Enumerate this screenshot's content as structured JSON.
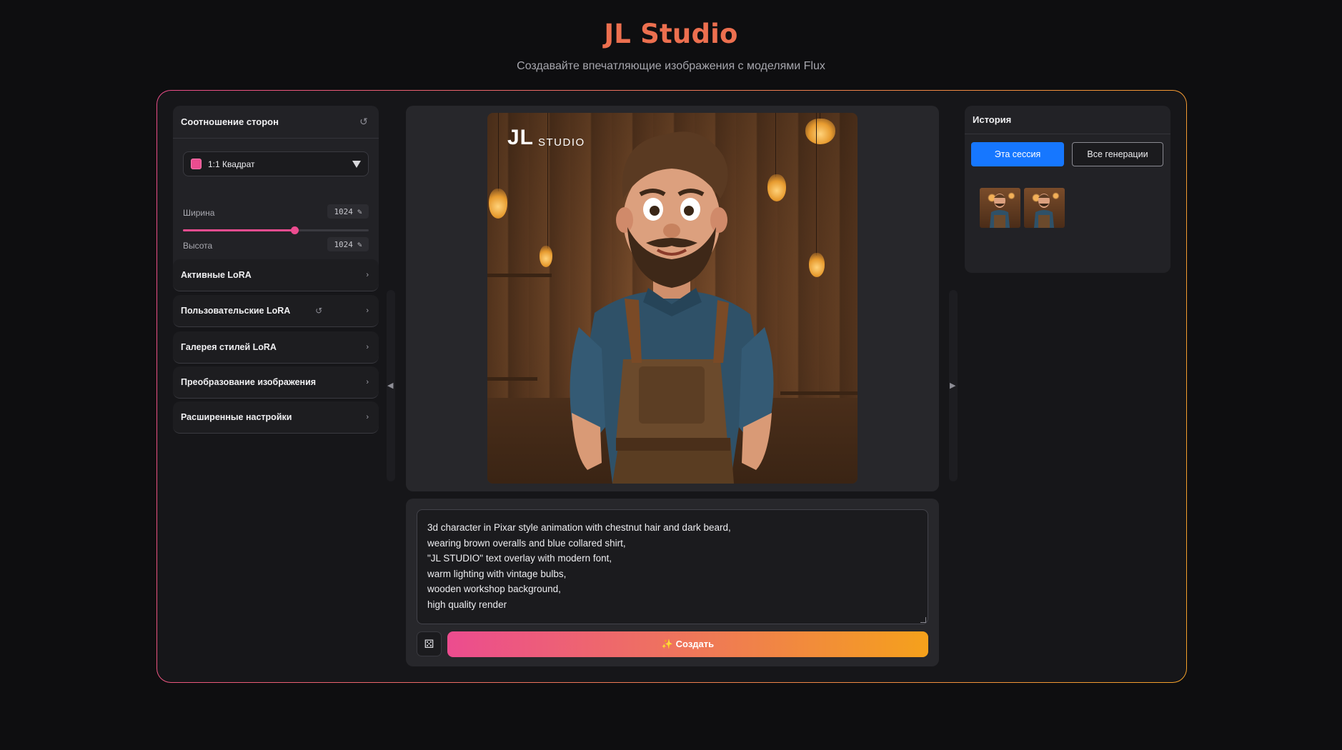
{
  "header": {
    "title": "JL Studio",
    "subtitle": "Создавайте впечатляющие изображения с моделями Flux"
  },
  "aspect": {
    "title": "Соотношение сторон",
    "selected": "1:1 Квадрат",
    "width_label": "Ширина",
    "width_value": "1024",
    "height_label": "Высота",
    "height_value": "1024",
    "width_fraction": 0.6,
    "height_fraction": 0.6,
    "accent_color": "#ec4c8f"
  },
  "accordions": [
    {
      "label": "Активные LoRA"
    },
    {
      "label": "Пользовательские LoRA"
    },
    {
      "label": "Галерея стилей LoRA"
    },
    {
      "label": "Преобразование изображения"
    },
    {
      "label": "Расширенные настройки"
    }
  ],
  "image": {
    "logo_main": "JL",
    "logo_sub": "STUDIO"
  },
  "prompt": {
    "text": "3d character in Pixar style animation with chestnut hair and dark beard,\nwearing brown overalls and blue collared shirt,\n\"JL STUDIO\" text overlay with modern font,\nwarm lighting with vintage bulbs,\nwooden workshop background,\nhigh quality render",
    "generate_label": "✨ Создать",
    "dice_icon": "dice-icon"
  },
  "history": {
    "title": "История",
    "tab_session": "Эта сессия",
    "tab_all": "Все генерации",
    "active_color": "#1677ff"
  }
}
